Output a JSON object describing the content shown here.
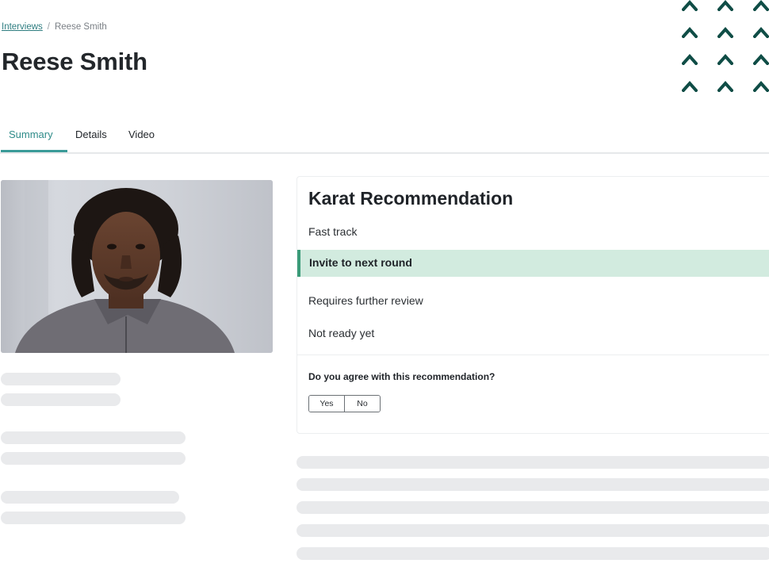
{
  "breadcrumb": {
    "link_label": "Interviews",
    "separator": "/",
    "current": "Reese Smith"
  },
  "page": {
    "title": "Reese Smith"
  },
  "tabs": [
    {
      "label": "Summary",
      "active": true
    },
    {
      "label": "Details",
      "active": false
    },
    {
      "label": "Video",
      "active": false
    }
  ],
  "recommendation": {
    "title": "Karat Recommendation",
    "options": [
      {
        "label": "Fast track",
        "selected": false
      },
      {
        "label": "Invite to next round",
        "selected": true
      },
      {
        "label": "Requires further review",
        "selected": false
      },
      {
        "label": "Not ready yet",
        "selected": false
      }
    ],
    "question": "Do you agree with this recommendation?",
    "yes_label": "Yes",
    "no_label": "No"
  },
  "decor": {
    "icon": "chevron-up-icon",
    "color": "#0f4d46"
  },
  "colors": {
    "accent": "#2e8b89",
    "selected_bg": "#d2ebdf",
    "selected_bar": "#3a9b78",
    "skeleton": "#e9eaec"
  },
  "video": {
    "icon": "candidate-video-frame"
  }
}
